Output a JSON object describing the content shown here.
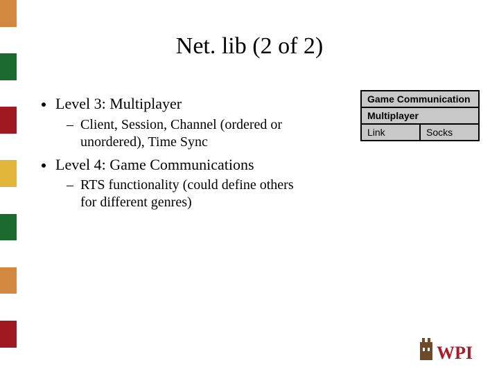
{
  "title": "Net. lib (2 of 2)",
  "bullets": [
    {
      "text": "Level 3: Multiplayer",
      "subs": [
        "Client, Session, Channel (ordered or unordered), Time Sync"
      ]
    },
    {
      "text": "Level 4: Game Communications",
      "subs": [
        "RTS functionality (could define others for different genres)"
      ]
    }
  ],
  "diagram": {
    "rows": [
      "Game Communication",
      "Multiplayer",
      "Link"
    ],
    "bottom": [
      "Link",
      "Socks"
    ]
  },
  "sidebar_colors": [
    "#d2893f",
    "#ffffff",
    "#1a6a2d",
    "#ffffff",
    "#a01820",
    "#ffffff",
    "#e0b53a",
    "#ffffff",
    "#1a6a2d",
    "#ffffff",
    "#d2893f",
    "#ffffff",
    "#a01820",
    "#ffffff"
  ],
  "logo": {
    "text": "WPI",
    "accent": "#b01824",
    "icon": "#6f4a2a"
  }
}
